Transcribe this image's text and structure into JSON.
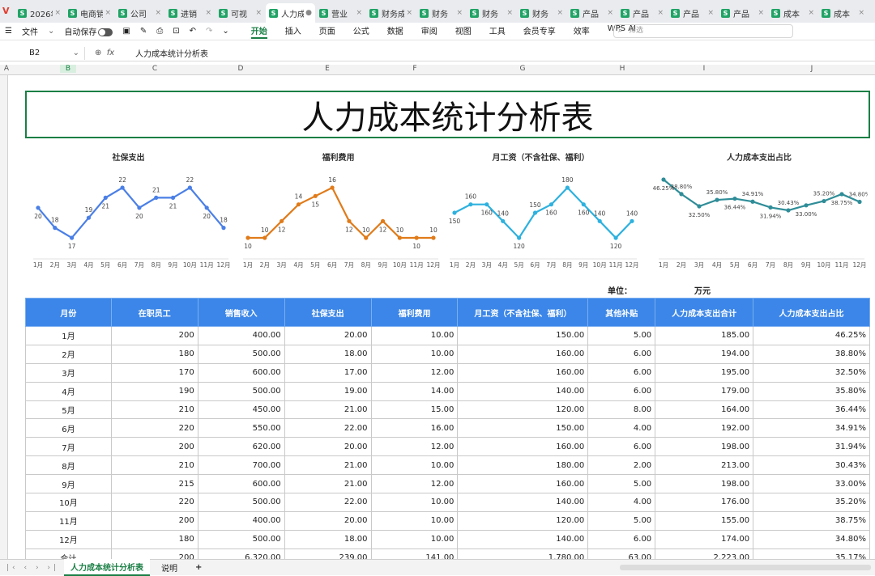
{
  "tabs": [
    {
      "label": "2026年",
      "active": false
    },
    {
      "label": "电商销售",
      "active": false
    },
    {
      "label": "公司",
      "active": false
    },
    {
      "label": "进销",
      "active": false
    },
    {
      "label": "可视",
      "active": false
    },
    {
      "label": "人力成",
      "active": true
    },
    {
      "label": "营业",
      "active": false
    },
    {
      "label": "财务成本",
      "active": false
    },
    {
      "label": "财务",
      "active": false
    },
    {
      "label": "财务",
      "active": false
    },
    {
      "label": "财务",
      "active": false
    },
    {
      "label": "产品",
      "active": false
    },
    {
      "label": "产品",
      "active": false
    },
    {
      "label": "产品",
      "active": false
    },
    {
      "label": "产品",
      "active": false
    },
    {
      "label": "成本",
      "active": false
    },
    {
      "label": "成本",
      "active": false
    }
  ],
  "toolbar": {
    "file": "文件",
    "autosave": "自动保存",
    "search_placeholder": "筛选",
    "menus": [
      "开始",
      "插入",
      "页面",
      "公式",
      "数据",
      "审阅",
      "视图",
      "工具",
      "会员专享",
      "效率",
      "WPS AI"
    ],
    "active_menu": "开始"
  },
  "formula": {
    "cell": "B2",
    "content": "人力成本统计分析表"
  },
  "columns": [
    "A",
    "B",
    "C",
    "D",
    "E",
    "F",
    "G",
    "H",
    "I",
    "J"
  ],
  "title": "人力成本统计分析表",
  "unit_label": "单位：",
  "unit_value": "万元",
  "months": [
    "1月",
    "2月",
    "3月",
    "4月",
    "5月",
    "6月",
    "7月",
    "8月",
    "9月",
    "10月",
    "11月",
    "12月"
  ],
  "charts": [
    {
      "title": "社保支出",
      "color": "#4a7fe6",
      "values": [
        20,
        18,
        17,
        19,
        21,
        22,
        20,
        21,
        21,
        22,
        20,
        18
      ],
      "labels": [
        "20",
        "18",
        "17",
        "19",
        "21",
        "22",
        "20",
        "21",
        "21",
        "22",
        "20",
        "18"
      ]
    },
    {
      "title": "福利费用",
      "color": "#e07b1a",
      "values": [
        10,
        10,
        12,
        14,
        15,
        16,
        12,
        10,
        12,
        10,
        10,
        10
      ],
      "labels": [
        "10",
        "10",
        "12",
        "14",
        "15",
        "16",
        "12",
        "10",
        "12",
        "10",
        "10",
        "10"
      ]
    },
    {
      "title": "月工资（不含社保、福利）",
      "color": "#2eb1de",
      "values": [
        150,
        160,
        160,
        140,
        120,
        150,
        160,
        180,
        160,
        140,
        120,
        140
      ],
      "labels": [
        "150",
        "160",
        "160",
        "140",
        "120",
        "150",
        "160",
        "180",
        "160",
        "140",
        "120",
        "140"
      ]
    },
    {
      "title": "人力成本支出占比",
      "color": "#2f8d98",
      "values": [
        46.25,
        38.8,
        32.5,
        35.8,
        36.44,
        34.91,
        31.94,
        30.43,
        33.0,
        35.2,
        38.75,
        34.8
      ],
      "labels": [
        "46.25%",
        "38.80%",
        "32.50%",
        "35.80%",
        "36.44%",
        "34.91%",
        "31.94%",
        "30.43%",
        "33.00%",
        "35.20%",
        "38.75%",
        "34.80%"
      ]
    }
  ],
  "table": {
    "headers": [
      "月份",
      "在职员工",
      "销售收入",
      "社保支出",
      "福利费用",
      "月工资（不含社保、福利）",
      "其他补贴",
      "人力成本支出合计",
      "人力成本支出占比"
    ],
    "rows": [
      [
        "1月",
        "200",
        "400.00",
        "20.00",
        "10.00",
        "150.00",
        "5.00",
        "185.00",
        "46.25%"
      ],
      [
        "2月",
        "180",
        "500.00",
        "18.00",
        "10.00",
        "160.00",
        "6.00",
        "194.00",
        "38.80%"
      ],
      [
        "3月",
        "170",
        "600.00",
        "17.00",
        "12.00",
        "160.00",
        "6.00",
        "195.00",
        "32.50%"
      ],
      [
        "4月",
        "190",
        "500.00",
        "19.00",
        "14.00",
        "140.00",
        "6.00",
        "179.00",
        "35.80%"
      ],
      [
        "5月",
        "210",
        "450.00",
        "21.00",
        "15.00",
        "120.00",
        "8.00",
        "164.00",
        "36.44%"
      ],
      [
        "6月",
        "220",
        "550.00",
        "22.00",
        "16.00",
        "150.00",
        "4.00",
        "192.00",
        "34.91%"
      ],
      [
        "7月",
        "200",
        "620.00",
        "20.00",
        "12.00",
        "160.00",
        "6.00",
        "198.00",
        "31.94%"
      ],
      [
        "8月",
        "210",
        "700.00",
        "21.00",
        "10.00",
        "180.00",
        "2.00",
        "213.00",
        "30.43%"
      ],
      [
        "9月",
        "215",
        "600.00",
        "21.00",
        "12.00",
        "160.00",
        "5.00",
        "198.00",
        "33.00%"
      ],
      [
        "10月",
        "220",
        "500.00",
        "22.00",
        "10.00",
        "140.00",
        "4.00",
        "176.00",
        "35.20%"
      ],
      [
        "11月",
        "200",
        "400.00",
        "20.00",
        "10.00",
        "120.00",
        "5.00",
        "155.00",
        "38.75%"
      ],
      [
        "12月",
        "180",
        "500.00",
        "18.00",
        "10.00",
        "140.00",
        "6.00",
        "174.00",
        "34.80%"
      ],
      [
        "合计",
        "200",
        "6,320.00",
        "239.00",
        "141.00",
        "1,780.00",
        "63.00",
        "2,223.00",
        "35.17%"
      ]
    ]
  },
  "sheets": {
    "active": "人力成本统计分析表",
    "other": "说明",
    "add": "+"
  },
  "chart_data": [
    {
      "type": "line",
      "title": "社保支出",
      "categories": [
        "1月",
        "2月",
        "3月",
        "4月",
        "5月",
        "6月",
        "7月",
        "8月",
        "9月",
        "10月",
        "11月",
        "12月"
      ],
      "values": [
        20,
        18,
        17,
        19,
        21,
        22,
        20,
        21,
        21,
        22,
        20,
        18
      ]
    },
    {
      "type": "line",
      "title": "福利费用",
      "categories": [
        "1月",
        "2月",
        "3月",
        "4月",
        "5月",
        "6月",
        "7月",
        "8月",
        "9月",
        "10月",
        "11月",
        "12月"
      ],
      "values": [
        10,
        10,
        12,
        14,
        15,
        16,
        12,
        10,
        12,
        10,
        10,
        10
      ]
    },
    {
      "type": "line",
      "title": "月工资（不含社保、福利）",
      "categories": [
        "1月",
        "2月",
        "3月",
        "4月",
        "5月",
        "6月",
        "7月",
        "8月",
        "9月",
        "10月",
        "11月",
        "12月"
      ],
      "values": [
        150,
        160,
        160,
        140,
        120,
        150,
        160,
        180,
        160,
        140,
        120,
        140
      ]
    },
    {
      "type": "line",
      "title": "人力成本支出占比",
      "categories": [
        "1月",
        "2月",
        "3月",
        "4月",
        "5月",
        "6月",
        "7月",
        "8月",
        "9月",
        "10月",
        "11月",
        "12月"
      ],
      "values": [
        46.25,
        38.8,
        32.5,
        35.8,
        36.44,
        34.91,
        31.94,
        30.43,
        33.0,
        35.2,
        38.75,
        34.8
      ]
    }
  ]
}
